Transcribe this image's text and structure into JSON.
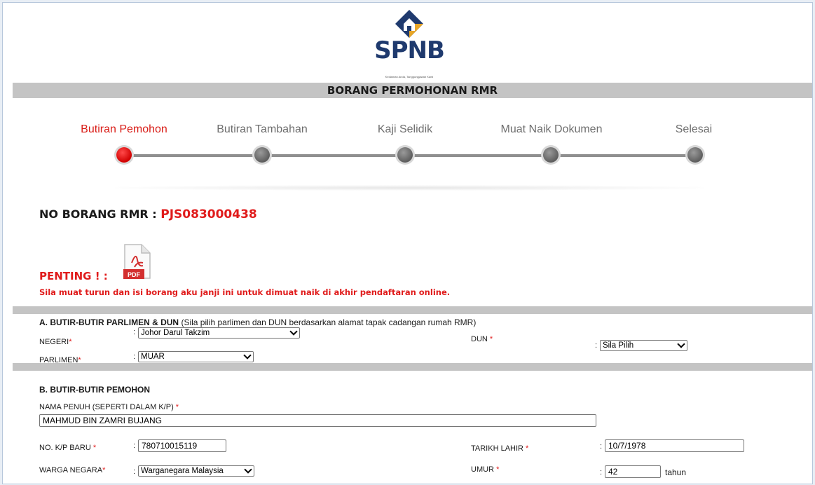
{
  "header": {
    "logo_text": "SPNB",
    "logo_tagline": "Kediaman Anda, Tanggungjawab Kami",
    "form_title": "BORANG PERMOHONAN RMR"
  },
  "steps": [
    {
      "label": "Butiran Pemohon",
      "active": true
    },
    {
      "label": "Butiran Tambahan",
      "active": false
    },
    {
      "label": "Kaji Selidik",
      "active": false
    },
    {
      "label": "Muat Naik Dokumen",
      "active": false
    },
    {
      "label": "Selesai",
      "active": false
    }
  ],
  "form_number": {
    "label": "NO BORANG RMR : ",
    "value": "PJS083000438"
  },
  "notice": {
    "penting": "PENTING ! :",
    "pdf_icon": "pdf-file-icon",
    "text": "Sila muat turun dan isi borang aku janji ini untuk dimuat naik di akhir pendaftaran online."
  },
  "section_a": {
    "title": "A. BUTIR-BUTIR PARLIMEN & DUN",
    "note": "(Sila pilih parlimen dan DUN berdasarkan alamat tapak cadangan rumah RMR)",
    "negeri_label": "NEGERI",
    "negeri_value": "Johor Darul Takzim",
    "parlimen_label": "PARLIMEN",
    "parlimen_value": "MUAR",
    "dun_label": "DUN",
    "dun_value": "Sila Pilih"
  },
  "section_b": {
    "title": "B. BUTIR-BUTIR PEMOHON",
    "nama_label": "NAMA PENUH (SEPERTI DALAM K/P)",
    "nama_value": "MAHMUD BIN ZAMRI BUJANG",
    "kp_label": "NO. K/P BARU",
    "kp_value": "780710015119",
    "tarikh_label": "TARIKH LAHIR",
    "tarikh_value": "10/7/1978",
    "warga_label": "WARGA NEGARA",
    "warga_value": "Warganegara Malaysia",
    "umur_label": "UMUR",
    "umur_value": "42",
    "umur_unit": "tahun"
  },
  "required_mark": "*",
  "colon": ":",
  "colors": {
    "accent_red": "#e01b1b",
    "band_gray": "#c4c4c4",
    "logo_blue": "#1f3a6e",
    "logo_gold": "#e8a628"
  }
}
